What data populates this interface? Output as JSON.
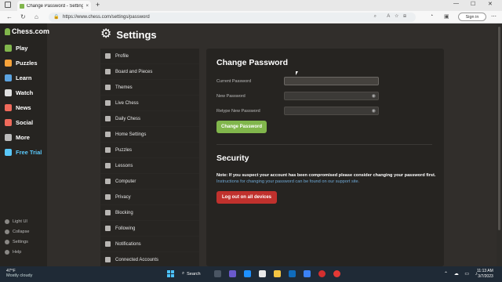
{
  "browser": {
    "tab_title": "Change Password - Settings - Ch",
    "tab_close": "×",
    "new_tab": "+",
    "url": "https://www.chess.com/settings/password",
    "sign_in": "Sign in",
    "menu": "⋯"
  },
  "nav": {
    "logo": "Chess.com",
    "items": [
      {
        "label": "Play",
        "color": "#81b64c"
      },
      {
        "label": "Puzzles",
        "color": "#f7a33a"
      },
      {
        "label": "Learn",
        "color": "#5ba3e0"
      },
      {
        "label": "Watch",
        "color": "#e0e0e0"
      },
      {
        "label": "News",
        "color": "#ef6a5b"
      },
      {
        "label": "Social",
        "color": "#ef6a5b"
      },
      {
        "label": "More",
        "color": "#bbbbbb"
      },
      {
        "label": "Free Trial",
        "color": "#5ac8fa"
      }
    ],
    "footer": [
      "Light UI",
      "Collapse",
      "Settings",
      "Help"
    ]
  },
  "settings": {
    "title": "Settings",
    "items": [
      "Profile",
      "Board and Pieces",
      "Themes",
      "Live Chess",
      "Daily Chess",
      "Home Settings",
      "Puzzles",
      "Lessons",
      "Computer",
      "Privacy",
      "Blocking",
      "Following",
      "Notifications",
      "Connected Accounts"
    ]
  },
  "change_password": {
    "title": "Change Password",
    "current_label": "Current Password",
    "new_label": "New Password",
    "retype_label": "Retype New Password",
    "button": "Change Password"
  },
  "security": {
    "title": "Security",
    "note_bold": "Note: If you suspect your account has been compromised please consider changing your password first.",
    "note_link": "Instructions for changing your password can be found on our support site.",
    "button": "Log out on all devices"
  },
  "taskbar": {
    "temp": "47°F",
    "condition": "Mostly cloudy",
    "search": "Search",
    "time": "11:13 AM",
    "date": "3/7/2023"
  }
}
